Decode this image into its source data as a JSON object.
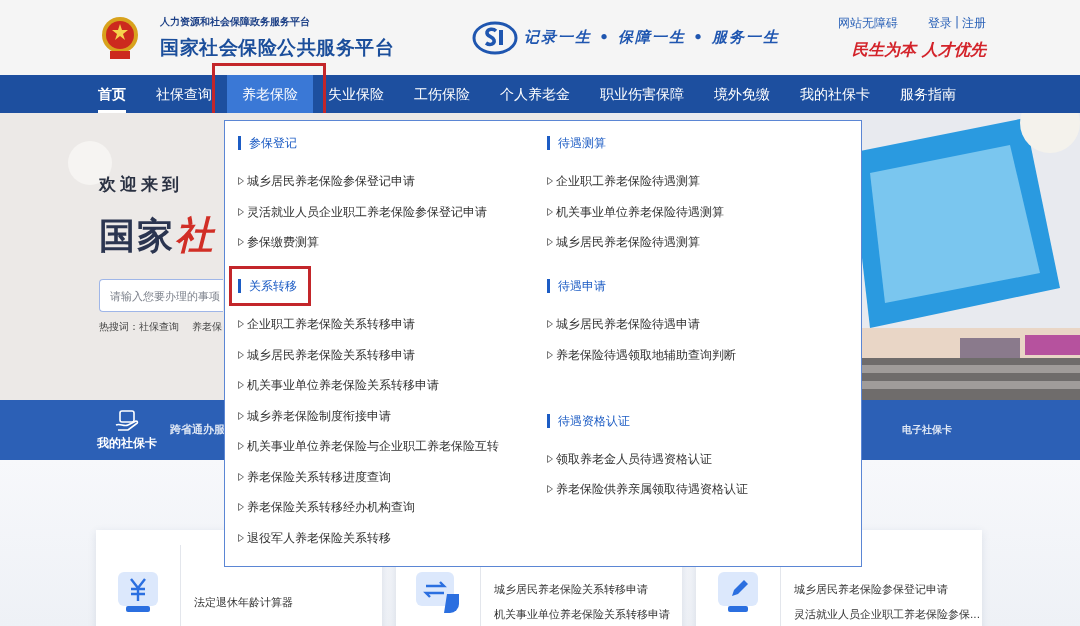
{
  "header": {
    "subtitle": "人力资源和社会保障政务服务平台",
    "title": "国家社会保险公共服务平台",
    "slogan": "记录一生 • 保障一生 • 服务一生",
    "accessibility_link": "网站无障碍",
    "login": "登录",
    "separator": "|",
    "register": "注册",
    "motto": "民生为本 人才优先"
  },
  "nav": [
    {
      "label": "首页",
      "selected": true,
      "open": false,
      "highlighted": false
    },
    {
      "label": "社保查询",
      "selected": false,
      "open": false,
      "highlighted": false
    },
    {
      "label": "养老保险",
      "selected": false,
      "open": true,
      "highlighted": true
    },
    {
      "label": "失业保险",
      "selected": false,
      "open": false,
      "highlighted": false
    },
    {
      "label": "工伤保险",
      "selected": false,
      "open": false,
      "highlighted": false
    },
    {
      "label": "个人养老金",
      "selected": false,
      "open": false,
      "highlighted": false
    },
    {
      "label": "职业伤害保障",
      "selected": false,
      "open": false,
      "highlighted": false
    },
    {
      "label": "境外免缴",
      "selected": false,
      "open": false,
      "highlighted": false
    },
    {
      "label": "我的社保卡",
      "selected": false,
      "open": false,
      "highlighted": false
    },
    {
      "label": "服务指南",
      "selected": false,
      "open": false,
      "highlighted": false
    }
  ],
  "hero": {
    "welcome": "欢迎来到",
    "title_dark": "国家",
    "title_red": "社",
    "search": {
      "placeholder": "请输入您要办理的事项"
    },
    "hot_label": "热搜词：",
    "hot_words": [
      "社保查询",
      "养老保"
    ]
  },
  "quick_bar": [
    {
      "label": "我的社保卡",
      "kind": "icon"
    },
    {
      "label": "跨省通办服",
      "kind": "text"
    },
    {
      "label": "电子社保卡",
      "kind": "text"
    }
  ],
  "menu": {
    "columns": [
      [
        {
          "heading": "参保登记",
          "highlighted": false,
          "items": [
            "城乡居民养老保险参保登记申请",
            "灵活就业人员企业职工养老保险参保登记申请",
            "参保缴费测算"
          ]
        },
        {
          "heading": "关系转移",
          "highlighted": true,
          "items": [
            "企业职工养老保险关系转移申请",
            "城乡居民养老保险关系转移申请",
            "机关事业单位养老保险关系转移申请",
            "城乡养老保险制度衔接申请",
            "机关事业单位养老保险与企业职工养老保险互转",
            "养老保险关系转移进度查询",
            "养老保险关系转移经办机构查询",
            "退役军人养老保险关系转移"
          ]
        }
      ],
      [
        {
          "heading": "待遇测算",
          "highlighted": false,
          "items": [
            "企业职工养老保险待遇测算",
            "机关事业单位养老保险待遇测算",
            "城乡居民养老保险待遇测算"
          ]
        },
        {
          "heading": "待遇申请",
          "highlighted": false,
          "items": [
            "城乡居民养老保险待遇申请",
            "养老保险待遇领取地辅助查询判断"
          ]
        },
        {
          "heading": "待遇资格认证",
          "highlighted": false,
          "items": [
            "领取养老金人员待遇资格认证",
            "养老保险供养亲属领取待遇资格认证"
          ]
        }
      ]
    ]
  },
  "cards": [
    {
      "kind": "yuan",
      "links": [
        "法定退休年龄计算器"
      ]
    },
    {
      "kind": "transfer",
      "links": [
        "城乡居民养老保险关系转移申请",
        "机关事业单位养老保险关系转移申请"
      ]
    },
    {
      "kind": "pen",
      "links": [
        "城乡居民养老保险参保登记申请",
        "灵活就业人员企业职工养老保险参保..."
      ]
    }
  ]
}
